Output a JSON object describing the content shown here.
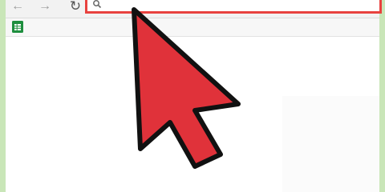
{
  "browser": {
    "toolbar": {
      "back_icon": "back-arrow-icon",
      "forward_icon": "forward-arrow-icon",
      "reload_icon": "reload-icon"
    },
    "omnibox": {
      "value": "",
      "icon": "search-icon",
      "highlight_color": "#e8423f"
    },
    "bookmarks": {
      "items": [
        {
          "icon": "sheets-icon",
          "color": "#1e8e3e"
        }
      ]
    },
    "window_border_color": "#c9e6b8"
  },
  "overlay": {
    "pointer_icon": "cursor-arrow-icon",
    "pointer_color": "#e0323a"
  }
}
